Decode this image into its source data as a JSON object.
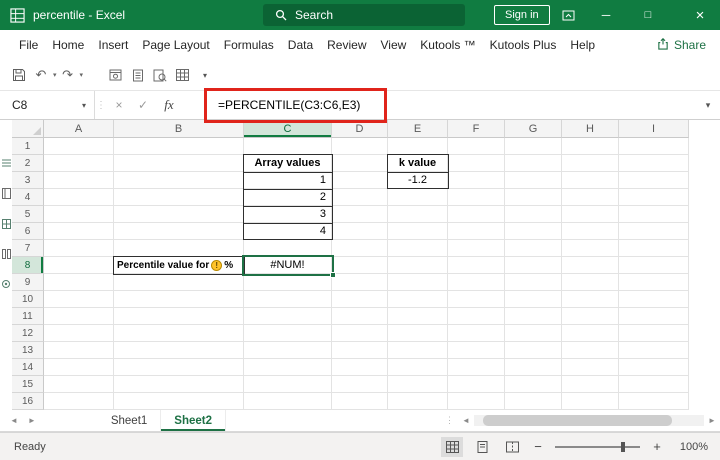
{
  "colors": {
    "excel_green": "#107C41",
    "accent_dark_green": "#1E7145",
    "annotation_red": "#E0241B",
    "warning_yellow": "#FFC32B"
  },
  "title_bar": {
    "title": "percentile  -  Excel",
    "search_placeholder": "Search",
    "sign_in_label": "Sign in"
  },
  "ribbon_tabs": [
    "File",
    "Home",
    "Insert",
    "Page Layout",
    "Formulas",
    "Data",
    "Review",
    "View",
    "Kutools ™",
    "Kutools Plus",
    "Help"
  ],
  "share_label": "Share",
  "formula_bar": {
    "name_box": "C8",
    "fx_label": "fx",
    "formula": "=PERCENTILE(C3:C6,E3)"
  },
  "grid": {
    "column_headers": [
      "A",
      "B",
      "C",
      "D",
      "E",
      "F",
      "G",
      "H",
      "I"
    ],
    "row_labels": [
      "1",
      "2",
      "3",
      "4",
      "5",
      "6",
      "7",
      "8",
      "9",
      "10",
      "11",
      "12",
      "13",
      "14",
      "15",
      "16"
    ],
    "highlight": {
      "column": "C",
      "row": "8"
    },
    "active_cell": "C8",
    "cells": {
      "C2": "Array values",
      "C3": "1",
      "C4": "2",
      "C5": "3",
      "C6": "4",
      "E2": "k value",
      "E3": "-1.2",
      "B8_text": "Percentile value for",
      "B8_suffix": "%",
      "C8": "#NUM!"
    }
  },
  "sheet_tabs": [
    "Sheet1",
    "Sheet2"
  ],
  "active_sheet": "Sheet2",
  "status_bar": {
    "mode": "Ready",
    "zoom": "100%"
  },
  "glyphs": {
    "caret_down": "▾",
    "chevron_down": "▾",
    "dots_vertical": "⋮",
    "cancel": "×",
    "check": "✓",
    "undo": "↶",
    "redo": "↷",
    "minimize": "─",
    "maximize": "□",
    "close": "×",
    "tab_prev": "◄",
    "tab_next": "►",
    "scroll_left": "◄",
    "scroll_right": "►",
    "zoom_out": "−",
    "zoom_in": "+",
    "warning_mark": "!"
  }
}
